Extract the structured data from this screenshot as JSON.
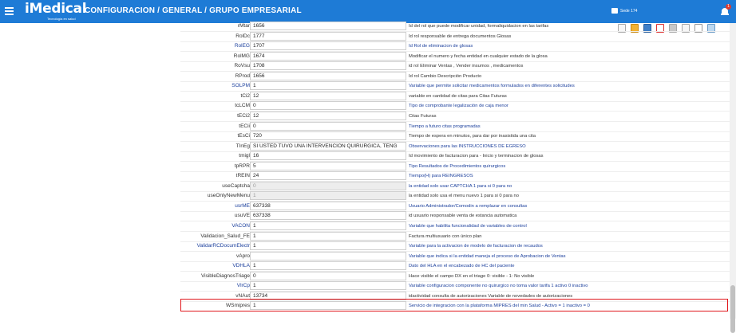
{
  "header": {
    "logo_text": "iMedical",
    "logo_tagline": "Tecnología en salud",
    "breadcrumb": "CONFIGURACION  /  GENERAL  /  GRUPO EMPRESARIAL",
    "sede": "Sede 174",
    "notification_count": "1"
  },
  "toolbar": {
    "icons": [
      "new-doc-icon",
      "lock-icon",
      "save-icon",
      "delete-icon",
      "print-icon",
      "download-icon",
      "help-icon",
      "sidebar-icon"
    ]
  },
  "rows": [
    {
      "name": "rMtar",
      "value": "1656",
      "desc": "Id del rol que puede modificar unidad, formaliquidacion en las tarifas",
      "link": false,
      "disabled": false,
      "desc_link": false
    },
    {
      "name": "RolDc",
      "value": "1777",
      "desc": "Id rol responsable de entrega documentos Glosas",
      "link": false,
      "disabled": false,
      "desc_link": false
    },
    {
      "name": "RolEG",
      "value": "1707",
      "desc": "Id Rol de eliminacion de glosas",
      "link": true,
      "disabled": false,
      "desc_link": true
    },
    {
      "name": "RolMG",
      "value": "1674",
      "desc": "Modificar el numero y fecha entidad en cualquier estado de la glosa",
      "link": false,
      "disabled": false,
      "desc_link": false
    },
    {
      "name": "RoVsu",
      "value": "1708",
      "desc": "id rol Eliminar Ventas , Vender insumos , medicamentos",
      "link": false,
      "disabled": false,
      "desc_link": false
    },
    {
      "name": "RProd",
      "value": "1656",
      "desc": "Id rol Cambio Descripción Producto",
      "link": false,
      "disabled": false,
      "desc_link": false
    },
    {
      "name": "SOLPM",
      "value": "1",
      "desc": "Variable que permite solicitar medicamentos formulados en diferentes solicitudes",
      "link": true,
      "disabled": false,
      "desc_link": true
    },
    {
      "name": "tCi2",
      "value": "12",
      "desc": "variable en cantidad de citas para Citas Futuras",
      "link": false,
      "disabled": false,
      "desc_link": false
    },
    {
      "name": "tcLCM",
      "value": "0",
      "desc": "Tipo de comprobante legalización de caja menor",
      "link": false,
      "disabled": false,
      "desc_link": true
    },
    {
      "name": "tECi2",
      "value": "12",
      "desc": "Citas Futuras",
      "link": false,
      "disabled": false,
      "desc_link": false
    },
    {
      "name": "tECii",
      "value": "0",
      "desc": "Tiempo a futuro citas programadas",
      "link": false,
      "disabled": false,
      "desc_link": true
    },
    {
      "name": "tEsCi",
      "value": "720",
      "desc": "Tiempo de espera en minutos, para dar por inasistida una cita",
      "link": false,
      "disabled": false,
      "desc_link": false
    },
    {
      "name": "TInEg",
      "value": "SI USTED TUVO UNA INTERVENCION QUIRURGICA, TENG",
      "desc": "Observaciones para las INSTRUCCIONES DE EGRESO",
      "link": false,
      "disabled": false,
      "desc_link": true
    },
    {
      "name": "tmigl",
      "value": "16",
      "desc": "Id movimiento de facturacion para - Inicio y terminacion de glosas",
      "link": false,
      "disabled": false,
      "desc_link": false
    },
    {
      "name": "tpRPR",
      "value": "5",
      "desc": "Tipo Resultados de Procedimientos quirurgicos",
      "link": false,
      "disabled": false,
      "desc_link": true
    },
    {
      "name": "tREIN",
      "value": "24",
      "desc": "Tiempo(H) para REINGRESOS",
      "link": false,
      "disabled": false,
      "desc_link": true
    },
    {
      "name": "useCaptcha",
      "value": "0",
      "desc": "la entidad solo usar CAPTCHA 1 para si 0 para no",
      "link": false,
      "disabled": true,
      "desc_link": true
    },
    {
      "name": "useOnlyNewMenu",
      "value": "1",
      "desc": "la entidad solo usa el menu nuevo 1 para si 0 para no",
      "link": false,
      "disabled": true,
      "desc_link": false
    },
    {
      "name": "usrME",
      "value": "637338",
      "desc": "Usuario Administrador/Comodin a remplazar en consultas",
      "link": true,
      "disabled": false,
      "desc_link": true
    },
    {
      "name": "usuVE",
      "value": "637338",
      "desc": "id usuario responsable venta de estancia automatica",
      "link": false,
      "disabled": false,
      "desc_link": false
    },
    {
      "name": "VACON",
      "value": "1",
      "desc": "Variable que habilita funcionalidad de variables de control",
      "link": true,
      "disabled": false,
      "desc_link": true
    },
    {
      "name": "Validacion_Salud_FE",
      "value": "1",
      "desc": "Factura multiusuario con único plan",
      "link": false,
      "disabled": false,
      "desc_link": false
    },
    {
      "name": "ValidarRCDocumElectr",
      "value": "1",
      "desc": "Variable para la activacion de modelo de facturacion de recaudos",
      "link": true,
      "disabled": false,
      "desc_link": true
    },
    {
      "name": "vApro",
      "value": "",
      "desc": "Variable que indica si la entidad maneja el proceso de Aprobacion de Ventas",
      "link": false,
      "disabled": false,
      "desc_link": true
    },
    {
      "name": "VDHLA",
      "value": "1",
      "desc": "Dato del HLA en el encabezado de HC del paciente",
      "link": true,
      "disabled": false,
      "desc_link": true
    },
    {
      "name": "VisibleDiagnosTriage",
      "value": "0",
      "desc": "Hace visible el campo DX en el triage 0: visible - 1: No visible",
      "link": false,
      "disabled": false,
      "desc_link": false
    },
    {
      "name": "VlrCp",
      "value": "1",
      "desc": "Variable configuracion componente no quirurgico no toma valor tarifa 1 activo 0 inactivo",
      "link": true,
      "disabled": false,
      "desc_link": true
    },
    {
      "name": "vNAut",
      "value": "13734",
      "desc": "idactividad consulta de autorizaciones Variable de novedades de autorizaciones",
      "link": false,
      "disabled": false,
      "desc_link": false
    },
    {
      "name": "WSmipres",
      "value": "1",
      "desc": "Servicio de integracion con la plataforma MIPRES del min Salud - Activo = 1 inactivo = 0",
      "link": false,
      "disabled": false,
      "desc_link": true
    }
  ]
}
